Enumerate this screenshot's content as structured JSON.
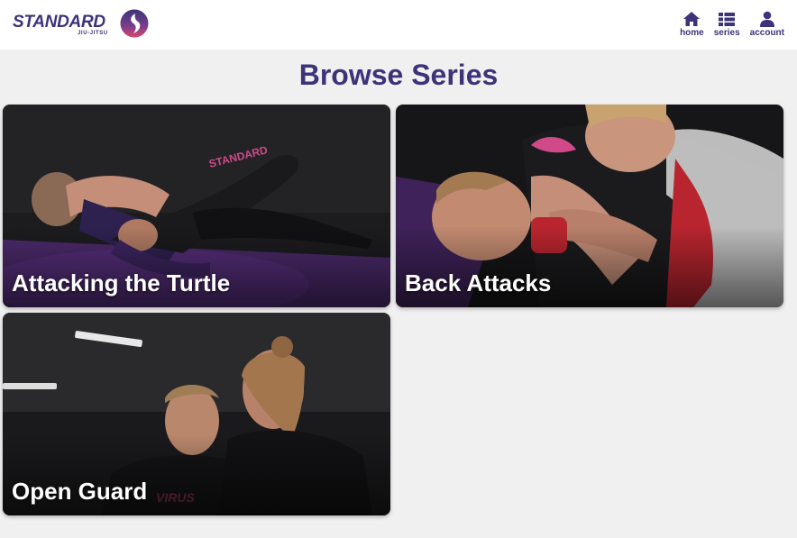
{
  "brand": {
    "name": "STANDARD",
    "sub": "JIU-JITSU",
    "accent": "#3d3378"
  },
  "nav": [
    {
      "label": "home",
      "icon": "home-icon"
    },
    {
      "label": "series",
      "icon": "list-icon"
    },
    {
      "label": "account",
      "icon": "user-icon"
    }
  ],
  "page": {
    "title": "Browse Series"
  },
  "series": [
    {
      "title": "Attacking the Turtle"
    },
    {
      "title": "Back Attacks"
    },
    {
      "title": "Open Guard"
    }
  ]
}
